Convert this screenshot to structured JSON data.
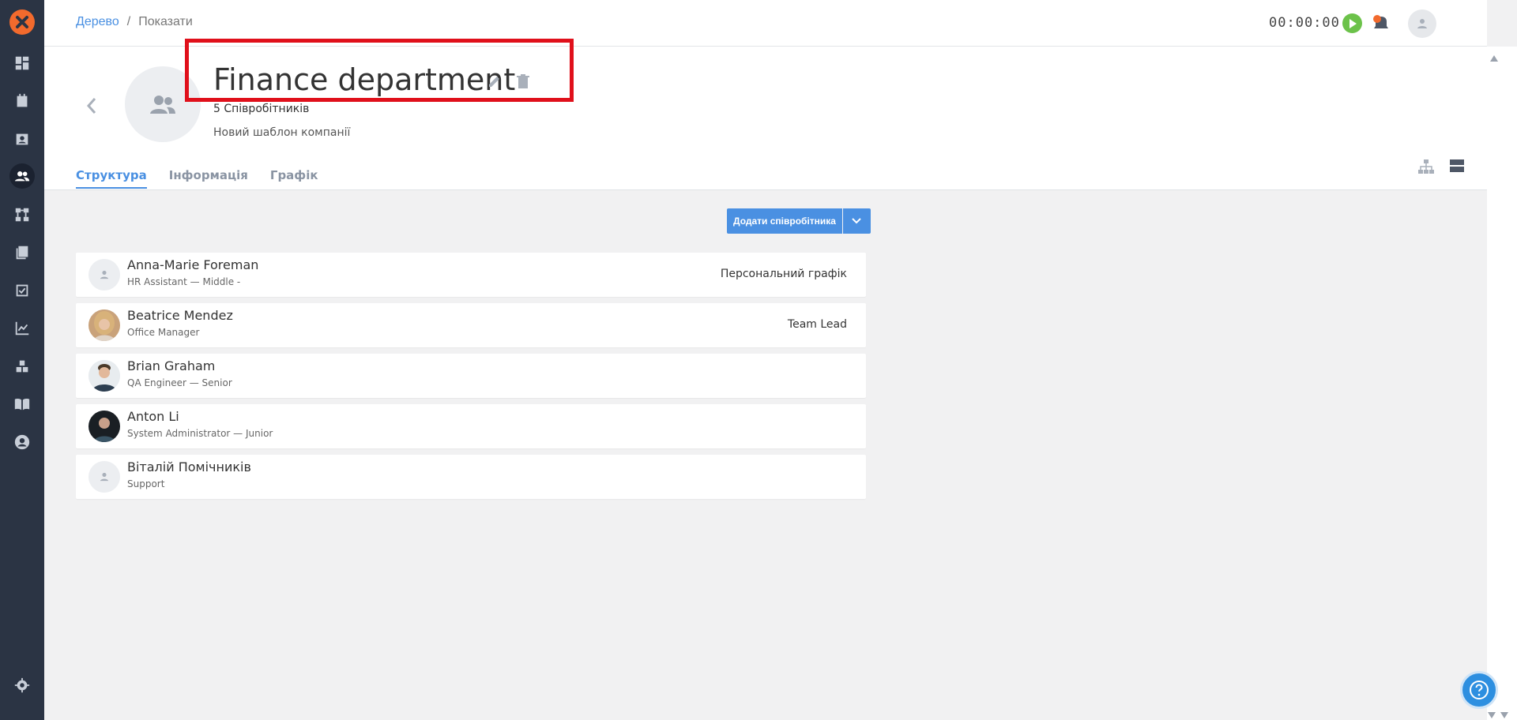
{
  "breadcrumb": {
    "link": "Дерево",
    "separator": "/",
    "current": "Показати"
  },
  "timer": "00:00:00",
  "department": {
    "title": "Finance department",
    "employee_count": "5 Співробітників",
    "template": "Новий шаблон компанії"
  },
  "tabs": [
    {
      "label": "Структура",
      "active": true
    },
    {
      "label": "Інформація",
      "active": false
    },
    {
      "label": "Графік",
      "active": false
    }
  ],
  "actions": {
    "add_employee": "Додати співробітника"
  },
  "employees": [
    {
      "name": "Anna-Marie Foreman",
      "role": "HR Assistant — Middle -",
      "right_label": "Персональний графік",
      "avatar": "placeholder"
    },
    {
      "name": "Beatrice Mendez",
      "role": "Office Manager",
      "right_label": "Team Lead",
      "avatar": "photo-blonde"
    },
    {
      "name": "Brian Graham",
      "role": "QA Engineer — Senior",
      "right_label": "",
      "avatar": "photo-man"
    },
    {
      "name": "Anton Li",
      "role": "System Administrator — Junior",
      "right_label": "",
      "avatar": "photo-dark"
    },
    {
      "name": "Віталій Помічників",
      "role": "Support",
      "right_label": "",
      "avatar": "placeholder"
    }
  ],
  "colors": {
    "sidebar": "#2b3444",
    "accent": "#4a90e2",
    "logo": "#f26a2d",
    "highlight": "#e0101b",
    "play": "#6cc24a"
  },
  "sidebar_icons": [
    "dashboard-icon",
    "calendar-icon",
    "contacts-icon",
    "team-icon",
    "structure-icon",
    "library-icon",
    "tasks-icon",
    "analytics-icon",
    "modules-icon",
    "book-icon",
    "profile-icon",
    "settings-icon"
  ]
}
